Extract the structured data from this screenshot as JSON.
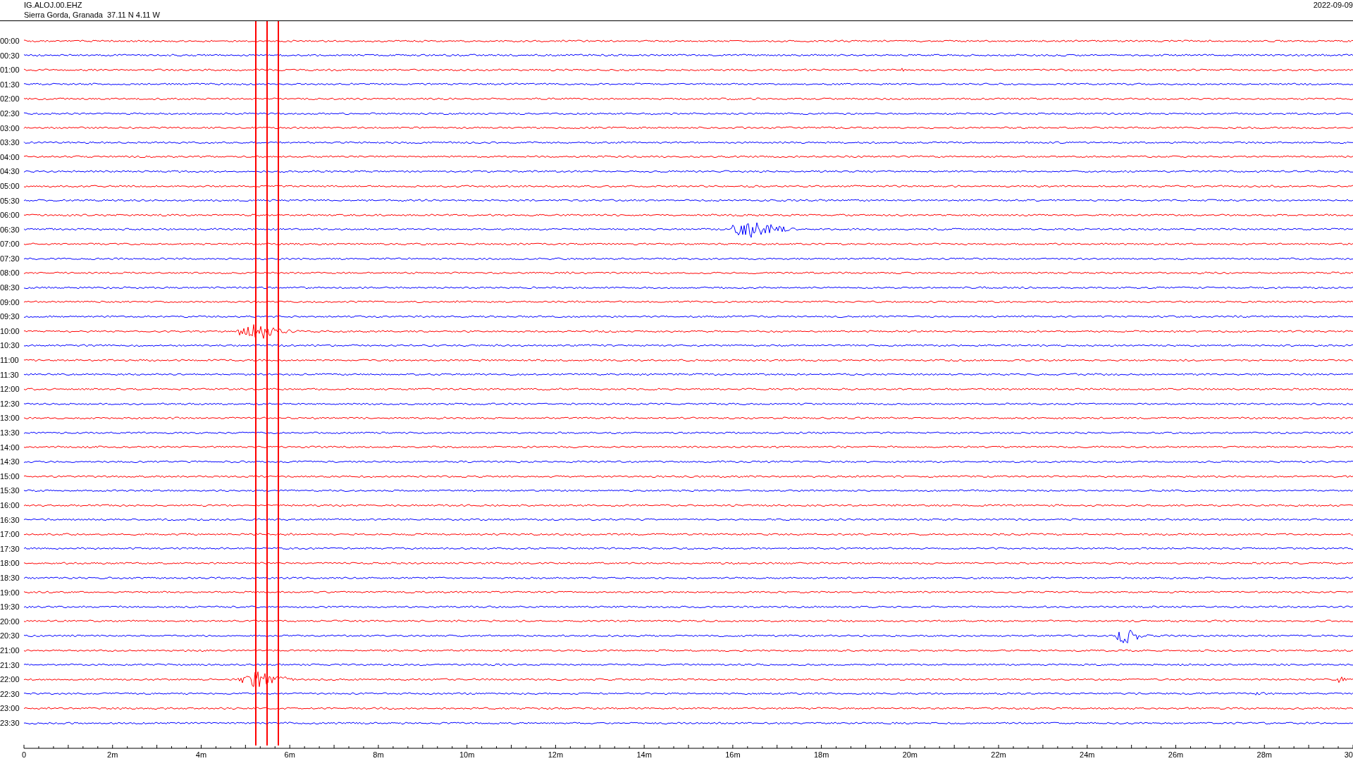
{
  "header": {
    "station": "IG.ALOJ.00.EHZ",
    "location": "Sierra Gorda, Granada  37.11 N 4.11 W",
    "date": "2022-09-09"
  },
  "rows": [
    {
      "label": "00:00",
      "color": "#ff0000"
    },
    {
      "label": "00:30",
      "color": "#0000ff"
    },
    {
      "label": "01:00",
      "color": "#ff0000"
    },
    {
      "label": "01:30",
      "color": "#0000ff"
    },
    {
      "label": "02:00",
      "color": "#ff0000"
    },
    {
      "label": "02:30",
      "color": "#0000ff"
    },
    {
      "label": "03:00",
      "color": "#ff0000"
    },
    {
      "label": "03:30",
      "color": "#0000ff"
    },
    {
      "label": "04:00",
      "color": "#ff0000"
    },
    {
      "label": "04:30",
      "color": "#0000ff"
    },
    {
      "label": "05:00",
      "color": "#ff0000"
    },
    {
      "label": "05:30",
      "color": "#0000ff"
    },
    {
      "label": "06:00",
      "color": "#ff0000"
    },
    {
      "label": "06:30",
      "color": "#0000ff"
    },
    {
      "label": "07:00",
      "color": "#ff0000"
    },
    {
      "label": "07:30",
      "color": "#0000ff"
    },
    {
      "label": "08:00",
      "color": "#ff0000"
    },
    {
      "label": "08:30",
      "color": "#0000ff"
    },
    {
      "label": "09:00",
      "color": "#ff0000"
    },
    {
      "label": "09:30",
      "color": "#0000ff"
    },
    {
      "label": "10:00",
      "color": "#ff0000"
    },
    {
      "label": "10:30",
      "color": "#0000ff"
    },
    {
      "label": "11:00",
      "color": "#ff0000"
    },
    {
      "label": "11:30",
      "color": "#0000ff"
    },
    {
      "label": "12:00",
      "color": "#ff0000"
    },
    {
      "label": "12:30",
      "color": "#0000ff"
    },
    {
      "label": "13:00",
      "color": "#ff0000"
    },
    {
      "label": "13:30",
      "color": "#0000ff"
    },
    {
      "label": "14:00",
      "color": "#ff0000"
    },
    {
      "label": "14:30",
      "color": "#0000ff"
    },
    {
      "label": "15:00",
      "color": "#ff0000"
    },
    {
      "label": "15:30",
      "color": "#0000ff"
    },
    {
      "label": "16:00",
      "color": "#ff0000"
    },
    {
      "label": "16:30",
      "color": "#0000ff"
    },
    {
      "label": "17:00",
      "color": "#ff0000"
    },
    {
      "label": "17:30",
      "color": "#0000ff"
    },
    {
      "label": "18:00",
      "color": "#ff0000"
    },
    {
      "label": "18:30",
      "color": "#0000ff"
    },
    {
      "label": "19:00",
      "color": "#ff0000"
    },
    {
      "label": "19:30",
      "color": "#0000ff"
    },
    {
      "label": "20:00",
      "color": "#ff0000"
    },
    {
      "label": "20:30",
      "color": "#0000ff"
    },
    {
      "label": "21:00",
      "color": "#ff0000"
    },
    {
      "label": "21:30",
      "color": "#0000ff"
    },
    {
      "label": "22:00",
      "color": "#ff0000"
    },
    {
      "label": "22:30",
      "color": "#0000ff"
    },
    {
      "label": "23:00",
      "color": "#ff0000"
    },
    {
      "label": "23:30",
      "color": "#0000ff"
    }
  ],
  "x_axis": {
    "tick_labels": [
      "0",
      "2m",
      "4m",
      "6m",
      "8m",
      "10m",
      "12m",
      "14m",
      "16m",
      "18m",
      "20m",
      "22m",
      "24m",
      "26m",
      "28m",
      "30"
    ]
  }
}
